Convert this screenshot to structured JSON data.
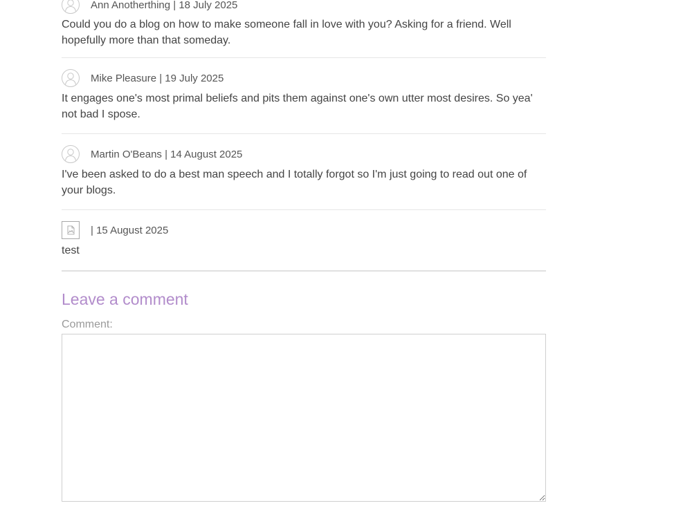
{
  "comments": [
    {
      "author": "Ann Anotherthing",
      "date": "18 July 2025",
      "meta": "Ann Anotherthing | 18 July 2025",
      "text": "Could you do a blog on how to make someone fall in love with you? Asking for a friend. Well hopefully more than that someday."
    },
    {
      "author": "Mike Pleasure",
      "date": "19 July 2025",
      "meta": "Mike Pleasure | 19 July 2025",
      "text": "It engages one's most primal beliefs and pits them against one's own utter most desires. So yea' not bad I spose."
    },
    {
      "author": "Martin O'Beans",
      "date": "14 August 2025",
      "meta": "Martin O'Beans | 14 August 2025",
      "text": "I've been asked to do a best man speech and I totally forgot so I'm just going to read out one of your blogs."
    },
    {
      "author": "",
      "date": "15 August 2025",
      "meta": "| 15 August 2025",
      "text": "test"
    }
  ],
  "form": {
    "title": "Leave a comment",
    "comment_label": "Comment:",
    "comment_value": ""
  },
  "icons": {
    "avatar": "default-avatar-icon",
    "broken_image": "broken-image-icon"
  },
  "colors": {
    "heading": "#b28ccb",
    "divider": "#e6e6e6"
  }
}
